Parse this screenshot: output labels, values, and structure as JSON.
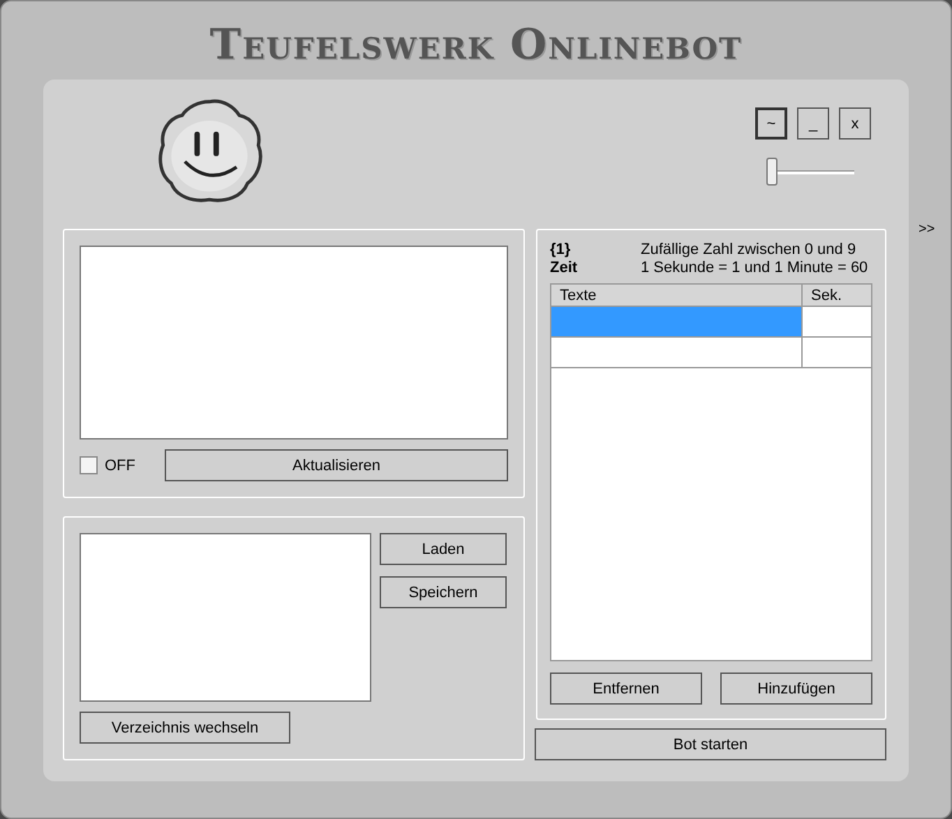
{
  "window": {
    "title": "Teufelswerk Onlinebot",
    "controls": [
      "~",
      "_",
      "x"
    ],
    "side_toggle": ">>"
  },
  "opacity_slider": {
    "level": 0.05
  },
  "log_panel": {
    "checkbox": {
      "label": "OFF",
      "checked": false
    },
    "refresh_button": "Aktualisieren"
  },
  "file_panel": {
    "load_button": "Laden",
    "save_button": "Speichern",
    "change_dir_button": "Verzeichnis wechseln"
  },
  "help": [
    {
      "key": "{1}",
      "text": "Zufällige Zahl zwischen 0 und 9"
    },
    {
      "key": "Zeit",
      "text": "1 Sekunde = 1 und 1 Minute = 60"
    }
  ],
  "table": {
    "columns": [
      "Texte",
      "Sek."
    ],
    "rows": [
      {
        "selected": true
      },
      {
        "selected": false
      }
    ]
  },
  "table_buttons": [
    "Entfernen",
    "Hinzufügen"
  ],
  "start_button": "Bot starten"
}
